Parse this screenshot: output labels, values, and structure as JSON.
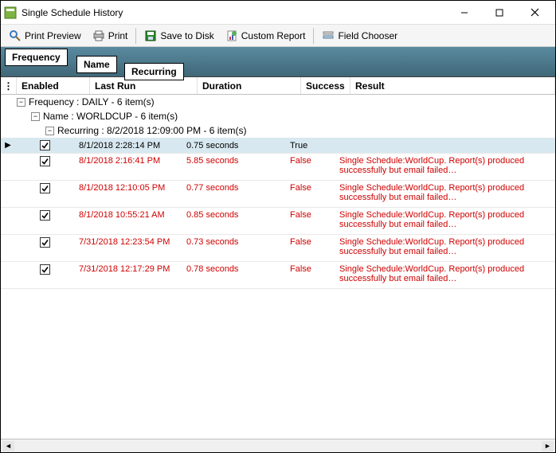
{
  "window": {
    "title": "Single Schedule History"
  },
  "toolbar": {
    "print_preview": "Print Preview",
    "print": "Print",
    "save_disk": "Save to Disk",
    "custom_report": "Custom Report",
    "field_chooser": "Field Chooser"
  },
  "group_tabs": {
    "frequency": "Frequency",
    "name": "Name",
    "recurring": "Recurring"
  },
  "columns": {
    "enabled": "Enabled",
    "last_run": "Last Run",
    "duration": "Duration",
    "success": "Success",
    "result": "Result"
  },
  "groups": {
    "g1": "Frequency : DAILY - 6 item(s)",
    "g2": "Name : WORLDCUP - 6 item(s)",
    "g3": "Recurring : 8/2/2018 12:09:00 PM - 6 item(s)"
  },
  "rows": [
    {
      "enabled": true,
      "last_run": "8/1/2018 2:28:14 PM",
      "duration": "0.75 seconds",
      "success": "True",
      "result": "",
      "error": false,
      "selected": true
    },
    {
      "enabled": true,
      "last_run": "8/1/2018 2:16:41 PM",
      "duration": "5.85 seconds",
      "success": "False",
      "result": "Single Schedule:WorldCup. Report(s) produced successfully but email failed…",
      "error": true,
      "selected": false
    },
    {
      "enabled": true,
      "last_run": "8/1/2018 12:10:05 PM",
      "duration": "0.77 seconds",
      "success": "False",
      "result": "Single Schedule:WorldCup. Report(s) produced successfully but email failed…",
      "error": true,
      "selected": false
    },
    {
      "enabled": true,
      "last_run": "8/1/2018 10:55:21 AM",
      "duration": "0.85 seconds",
      "success": "False",
      "result": "Single Schedule:WorldCup. Report(s) produced successfully but email failed…",
      "error": true,
      "selected": false
    },
    {
      "enabled": true,
      "last_run": "7/31/2018 12:23:54 PM",
      "duration": "0.73 seconds",
      "success": "False",
      "result": "Single Schedule:WorldCup. Report(s) produced successfully but email failed…",
      "error": true,
      "selected": false
    },
    {
      "enabled": true,
      "last_run": "7/31/2018 12:17:29 PM",
      "duration": "0.78 seconds",
      "success": "False",
      "result": "Single Schedule:WorldCup. Report(s) produced successfully but email failed…",
      "error": true,
      "selected": false
    }
  ]
}
